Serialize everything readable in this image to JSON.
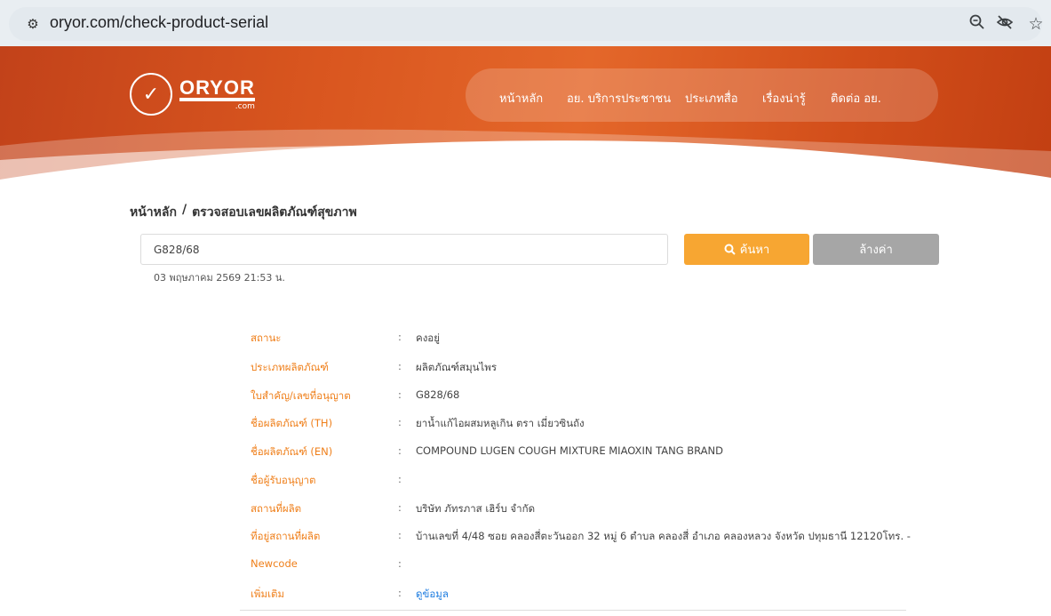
{
  "browser": {
    "url": "oryor.com/check-product-serial",
    "site_info_icon": "tune-icon",
    "icons": [
      "zoom-out-icon",
      "eye-off-icon",
      "star-icon"
    ]
  },
  "header": {
    "logo_text": "ORYOR",
    "logo_sub": ".com",
    "nav": [
      "หน้าหลัก",
      "อย. บริการประชาชน",
      "ประเภทสื่อ",
      "เรื่องน่ารู้",
      "ติดต่อ อย."
    ]
  },
  "breadcrumb": {
    "home": "หน้าหลัก",
    "separator": "/",
    "current": "ตรวจสอบเลขผลิตภัณฑ์สุขภาพ"
  },
  "search": {
    "value": "G828/68",
    "button_label": "ค้นหา",
    "clear_label": "ล้างค่า",
    "timestamp": "03 พฤษภาคม 2569 21:53 น."
  },
  "details": [
    {
      "label": "สถานะ",
      "value": "คงอยู่"
    },
    {
      "label": "ประเภทผลิตภัณฑ์",
      "value": "ผลิตภัณฑ์สมุนไพร"
    },
    {
      "label": "ใบสำคัญ/เลขที่อนุญาต",
      "value": "G828/68"
    },
    {
      "label": "ชื่อผลิตภัณฑ์ (TH)",
      "value": "ยาน้ำแก้ไอผสมหลูเกิน ตรา เมี่ยวซินถัง"
    },
    {
      "label": "ชื่อผลิตภัณฑ์ (EN)",
      "value": "COMPOUND LUGEN COUGH MIXTURE MIAOXIN TANG BRAND"
    },
    {
      "label": "ชื่อผู้รับอนุญาต",
      "value": ""
    },
    {
      "label": "สถานที่ผลิต",
      "value": "บริษัท ภัทรภาส เฮิร์บ จำกัด"
    },
    {
      "label": "ที่อยู่สถานที่ผลิต",
      "value": "บ้านเลขที่ 4/48 ซอย คลองสี่ตะวันออก 32 หมู่ 6 ตำบล คลองสี่ อำเภอ คลองหลวง จังหวัด ปทุมธานี 12120โทร. -"
    },
    {
      "label": "Newcode",
      "value": ""
    },
    {
      "label": "เพิ่มเติม",
      "value": "ดูข้อมูล"
    }
  ],
  "colon": ":",
  "colors": {
    "accent_orange": "#f7a632",
    "label_orange": "#ef7f1a",
    "link_blue": "#1f7de0",
    "hero_orange": "#d9561f"
  }
}
